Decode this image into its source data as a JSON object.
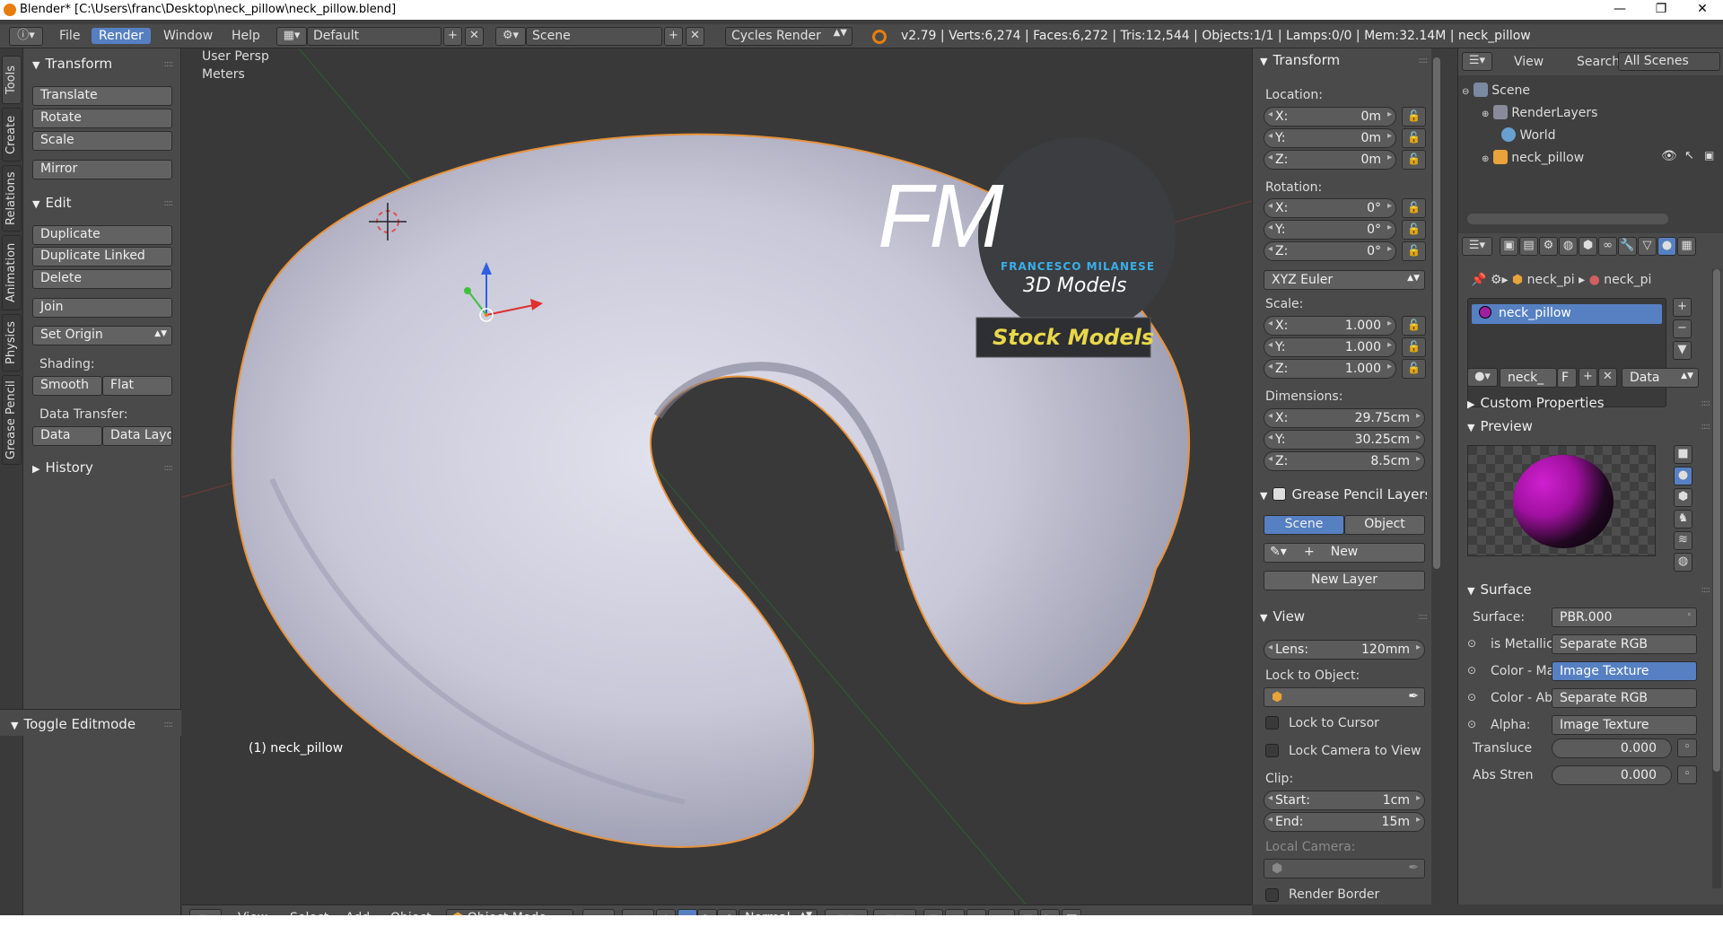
{
  "window": {
    "title": "Blender* [C:\\Users\\franc\\Desktop\\neck_pillow\\neck_pillow.blend]",
    "minimize": "—",
    "maximize": "❐",
    "close": "✕"
  },
  "info_header": {
    "menus": [
      "File",
      "Render",
      "Window",
      "Help"
    ],
    "layout": "Default",
    "scene": "Scene",
    "engine": "Cycles Render",
    "stats": "v2.79 | Verts:6,274 | Faces:6,272 | Tris:12,544 | Objects:1/1 | Lamps:0/0 | Mem:32.14M | neck_pillow"
  },
  "left_tabs": [
    "Tools",
    "Create",
    "Relations",
    "Animation",
    "Physics",
    "Grease Pencil"
  ],
  "tool_shelf": {
    "transform_title": "Transform",
    "translate": "Translate",
    "rotate": "Rotate",
    "scale": "Scale",
    "mirror": "Mirror",
    "edit_title": "Edit",
    "duplicate": "Duplicate",
    "duplicate_linked": "Duplicate Linked",
    "delete": "Delete",
    "join": "Join",
    "set_origin": "Set Origin",
    "shading_label": "Shading:",
    "smooth": "Smooth",
    "flat": "Flat",
    "data_transfer_label": "Data Transfer:",
    "data": "Data",
    "data_layout": "Data Layo",
    "history_title": "History",
    "toggle_editmode": "Toggle Editmode"
  },
  "viewport": {
    "view_name": "User Persp",
    "units": "Meters",
    "object_label": "(1) neck_pillow",
    "watermark": {
      "fm": "FM",
      "line1": "FRANCESCO MILANESE",
      "line2": "3D Models",
      "banner": "Stock Models"
    }
  },
  "n_panel": {
    "transform_title": "Transform",
    "location_label": "Location:",
    "location": {
      "x": "0m",
      "y": "0m",
      "z": "0m"
    },
    "rotation_label": "Rotation:",
    "rotation": {
      "x": "0°",
      "y": "0°",
      "z": "0°"
    },
    "rotation_mode": "XYZ Euler",
    "scale_label": "Scale:",
    "scale": {
      "x": "1.000",
      "y": "1.000",
      "z": "1.000"
    },
    "dimensions_label": "Dimensions:",
    "dimensions": {
      "x": "29.75cm",
      "y": "30.25cm",
      "z": "8.5cm"
    },
    "axis": {
      "x": "X:",
      "y": "Y:",
      "z": "Z:"
    },
    "gp_title": "Grease Pencil Layers",
    "gp_scene": "Scene",
    "gp_object": "Object",
    "gp_new": "New",
    "gp_new_layer": "New Layer",
    "view_title": "View",
    "lens_label": "Lens:",
    "lens_value": "120mm",
    "lock_object_label": "Lock to Object:",
    "lock_cursor": "Lock to Cursor",
    "lock_camera": "Lock Camera to View",
    "clip_label": "Clip:",
    "clip_start_label": "Start:",
    "clip_start": "1cm",
    "clip_end_label": "End:",
    "clip_end": "15m",
    "local_camera_label": "Local Camera:",
    "render_border": "Render Border"
  },
  "outliner": {
    "view": "View",
    "search": "Search",
    "filter": "All Scenes",
    "items": [
      "Scene",
      "RenderLayers",
      "World",
      "neck_pillow"
    ]
  },
  "properties": {
    "breadcrumb": [
      "neck_pi",
      "neck_pi"
    ],
    "material": "neck_pillow",
    "mat_field": "neck_",
    "mat_f": "F",
    "link": "Data",
    "custom_properties": "Custom Properties",
    "preview": "Preview",
    "surface_title": "Surface",
    "surface_label": "Surface:",
    "surface_value": "PBR.000",
    "inputs": [
      {
        "label": "is Metallic",
        "value": "Separate RGB",
        "active": false
      },
      {
        "label": "Color - Ma",
        "value": "Image Texture",
        "active": true
      },
      {
        "label": "Color - Ab",
        "value": "Separate RGB",
        "active": false
      },
      {
        "label": "Alpha:",
        "value": "Image Texture",
        "active": false
      }
    ],
    "translucency_label": "Transluce",
    "translucency": "0.000",
    "abs_strength_label": "Abs Stren",
    "abs_strength": "0.000"
  },
  "bottom_header": {
    "menus": [
      "View",
      "Select",
      "Add",
      "Object"
    ],
    "mode": "Object Mode",
    "orientation": "Normal"
  },
  "colors": {
    "accent": "#5680c2",
    "panel": "#4a4a4a",
    "viewport": "#393939",
    "selection_outline": "#e8923a",
    "gizmo_x": "#e03030",
    "gizmo_y": "#40c040",
    "gizmo_z": "#3060e0"
  }
}
